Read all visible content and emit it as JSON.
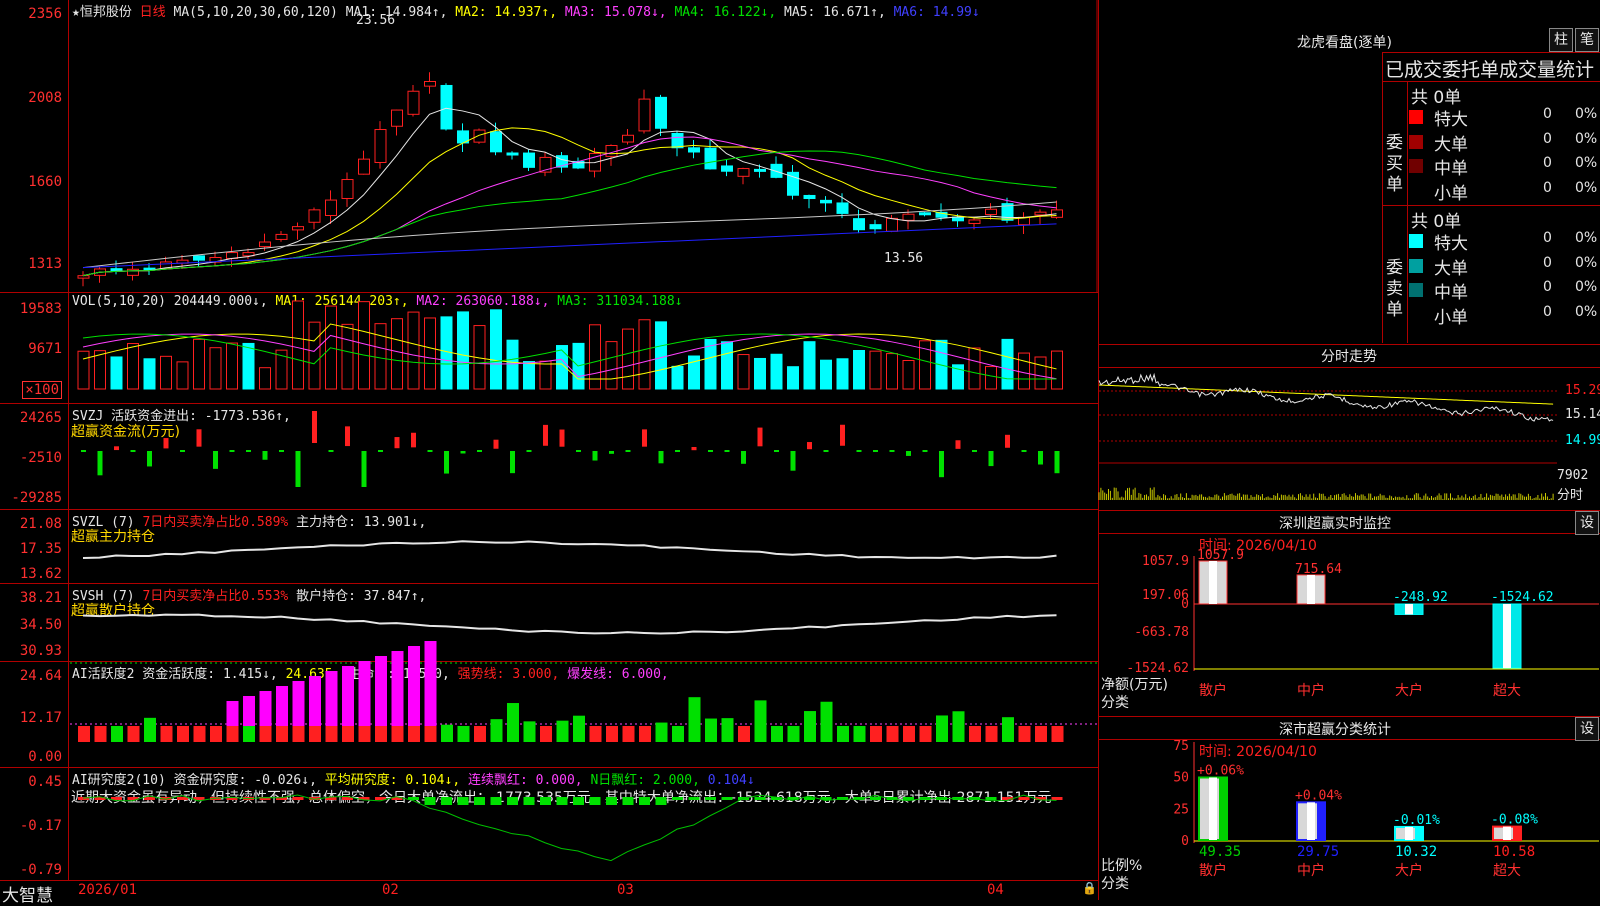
{
  "main": {
    "stock_name": "恒邦股份",
    "period": "日线",
    "ma_legend": [
      {
        "label": "MA(5,10,20,30,60,120)",
        "color": "#e6e6e6"
      },
      {
        "label": "MA1: 14.984↑,",
        "color": "#e6e6e6"
      },
      {
        "label": "MA2: 14.937↑,",
        "color": "#ffff00"
      },
      {
        "label": "MA3: 15.078↓,",
        "color": "#ff40ff"
      },
      {
        "label": "MA4: 16.122↓,",
        "color": "#00e000"
      },
      {
        "label": "MA5: 16.671↑,",
        "color": "#e6e6e6"
      },
      {
        "label": "MA6: 14.99↓",
        "color": "#4040ff"
      }
    ],
    "y_labels": [
      "2356",
      "2008",
      "1660",
      "1313"
    ],
    "high_mark": "23.56",
    "low_mark": "13.56"
  },
  "vol": {
    "legend": [
      {
        "label": "VOL(5,10,20)",
        "color": "#e6e6e6"
      },
      {
        "label": "204449.000↓,",
        "color": "#e6e6e6"
      },
      {
        "label": "MA1: 256144.203↑,",
        "color": "#ffff00"
      },
      {
        "label": "MA2: 263060.188↓,",
        "color": "#ff40ff"
      },
      {
        "label": "MA3: 311034.188↓",
        "color": "#00e000"
      }
    ],
    "y_labels": [
      "19583",
      "9671"
    ],
    "unit": "×100"
  },
  "svzj": {
    "legend": [
      {
        "label": "SVZJ  活跃资金进出: -1773.536↑,",
        "color": "#e6e6e6"
      }
    ],
    "subtitle": "超赢资金流(万元)",
    "y_labels": [
      "24265",
      "-2510",
      "-29285"
    ]
  },
  "svzl": {
    "legend": [
      {
        "label": "SVZL (7)",
        "color": "#e6e6e6"
      },
      {
        "label": "7日内买卖净占比0.589%",
        "color": "#ff2020"
      },
      {
        "label": "主力持仓: 13.901↓,",
        "color": "#e6e6e6"
      }
    ],
    "subtitle": "超赢主力持仓",
    "y_labels": [
      "21.08",
      "17.35",
      "13.62"
    ]
  },
  "svsh": {
    "legend": [
      {
        "label": "SVSH (7)",
        "color": "#e6e6e6"
      },
      {
        "label": "7日内买卖净占比0.553%",
        "color": "#ff2020"
      },
      {
        "label": "散户持仓: 37.847↑,",
        "color": "#e6e6e6"
      }
    ],
    "subtitle": "超赢散户持仓",
    "y_labels": [
      "38.21",
      "34.50",
      "30.93"
    ]
  },
  "ai1": {
    "legend": [
      {
        "label": "AI活跃度2",
        "color": "#e6e6e6"
      },
      {
        "label": "资金活跃度: 1.415↓,",
        "color": "#e6e6e6"
      },
      {
        "label": "24.635,",
        "color": "#ffff00"
      },
      {
        "label": "生命线: 1.560,",
        "color": "#e6e6e6"
      },
      {
        "label": "强势线: 3.000,",
        "color": "#ff2020"
      },
      {
        "label": "爆发线: 6.000,",
        "color": "#ff40ff"
      }
    ],
    "y_labels": [
      "24.64",
      "12.17",
      "0.00"
    ]
  },
  "ai2": {
    "legend": [
      {
        "label": "AI研究度2(10)",
        "color": "#e6e6e6"
      },
      {
        "label": "资金研究度: -0.026↓,",
        "color": "#e6e6e6"
      },
      {
        "label": "平均研究度: 0.104↓,",
        "color": "#ffff00"
      },
      {
        "label": "连续飘红: 0.000,",
        "color": "#ff40ff"
      },
      {
        "label": "N日飘红: 2.000,",
        "color": "#00e000"
      },
      {
        "label": "0.104↓",
        "color": "#4040ff"
      }
    ],
    "comment": "近期大资金虽有异动，但持续性不强，总体偏空，今日大单净流出：-1773.535万元，其中特大单净流出：-1524.618万元，大单5日累计净出-2871.151万元",
    "y_labels": [
      "0.45",
      "-0.17",
      "-0.79"
    ]
  },
  "xaxis": {
    "brand": "大智慧",
    "labels": [
      "2026/01",
      "02",
      "03",
      "04"
    ]
  },
  "right": {
    "lhb_title": "龙虎看盘(逐单)",
    "btn_bar": "柱",
    "btn_order": "笔",
    "table_header": "已成交委托单成交量统计",
    "buy_label": "委买单",
    "sell_label": "委卖单",
    "buy_total": "共 0单",
    "sell_total": "共 0单",
    "buy_rows": [
      {
        "name": "特大",
        "count": "0",
        "pct": "0%",
        "color": "#ff0000"
      },
      {
        "name": "大单",
        "count": "0",
        "pct": "0%",
        "color": "#a00000"
      },
      {
        "name": "中单",
        "count": "0",
        "pct": "0%",
        "color": "#700000"
      },
      {
        "name": "小单",
        "count": "0",
        "pct": "0%",
        "color": "#000000"
      }
    ],
    "sell_rows": [
      {
        "name": "特大",
        "count": "0",
        "pct": "0%",
        "color": "#00ffff"
      },
      {
        "name": "大单",
        "count": "0",
        "pct": "0%",
        "color": "#00a0a0"
      },
      {
        "name": "中单",
        "count": "0",
        "pct": "0%",
        "color": "#007070"
      },
      {
        "name": "小单",
        "count": "0",
        "pct": "0%",
        "color": "#000000"
      }
    ],
    "fs_title": "分时走势",
    "fs_labels": [
      "15.29",
      "15.14",
      "14.99"
    ],
    "fs_vol": "7902",
    "fs_vol_unit": "分时",
    "monitor_title": "深圳超赢实时监控",
    "monitor_btn": "设",
    "monitor_time": "时间: 2026/04/10",
    "monitor_y": [
      "1057.9",
      "197.06",
      "0",
      "-663.78",
      "-1524.62"
    ],
    "monitor_ylabel": "净额(万元)",
    "monitor_xlabel": "分类",
    "monitor_bars": [
      {
        "cat": "散户",
        "value": 1057.9,
        "label": "1057.9"
      },
      {
        "cat": "中户",
        "value": 715.64,
        "label": "715.64"
      },
      {
        "cat": "大户",
        "value": -248.92,
        "label": "-248.92"
      },
      {
        "cat": "超大",
        "value": -1524.62,
        "label": "-1524.62"
      }
    ],
    "stat_title": "深市超赢分类统计",
    "stat_btn": "设",
    "stat_time": "时间: 2026/04/10",
    "stat_y": [
      "75",
      "50",
      "25",
      "0"
    ],
    "stat_ylabel": "比例%",
    "stat_xlabel": "分类",
    "stat_bars": [
      {
        "cat": "散户",
        "value": 49.35,
        "change": "+0.06%",
        "color": "#00d000"
      },
      {
        "cat": "中户",
        "value": 29.75,
        "change": "+0.04%",
        "color": "#2020ff"
      },
      {
        "cat": "大户",
        "value": 10.32,
        "change": "-0.01%",
        "color": "#00ffff"
      },
      {
        "cat": "超大",
        "value": 10.58,
        "change": "-0.08%",
        "color": "#ff2020"
      }
    ]
  }
}
